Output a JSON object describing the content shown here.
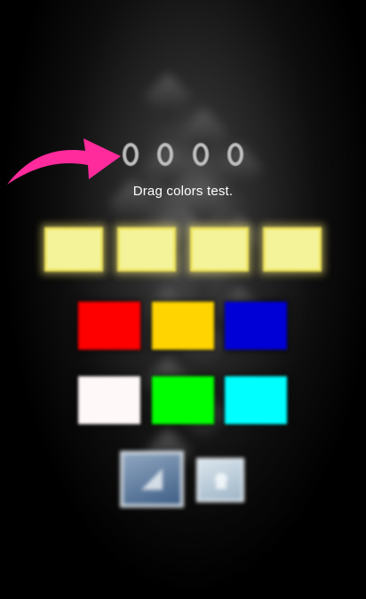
{
  "caption": "Drag colors test.",
  "progress": {
    "total_dots": 4,
    "filled_dots": 0
  },
  "drop_slots": [
    {
      "name": "slot-1",
      "color": "#f4f39a"
    },
    {
      "name": "slot-2",
      "color": "#f4f39a"
    },
    {
      "name": "slot-3",
      "color": "#f4f39a"
    },
    {
      "name": "slot-4",
      "color": "#f4f39a"
    }
  ],
  "swatches": [
    {
      "name": "red",
      "color": "#ff0000"
    },
    {
      "name": "yellow",
      "color": "#ffd400"
    },
    {
      "name": "blue",
      "color": "#0000d6"
    },
    {
      "name": "white",
      "color": "#fff8f8"
    },
    {
      "name": "green",
      "color": "#00ff00"
    },
    {
      "name": "cyan",
      "color": "#00ffff"
    }
  ],
  "icons": {
    "arrow": "pink-curved-arrow-icon",
    "left_button": "picture-frame-icon",
    "right_button": "small-picture-icon"
  },
  "colors": {
    "background": "#000000",
    "arrow": "#ff2a9c",
    "dot_outline": "#bdbdbd",
    "caption": "#ffffff"
  }
}
